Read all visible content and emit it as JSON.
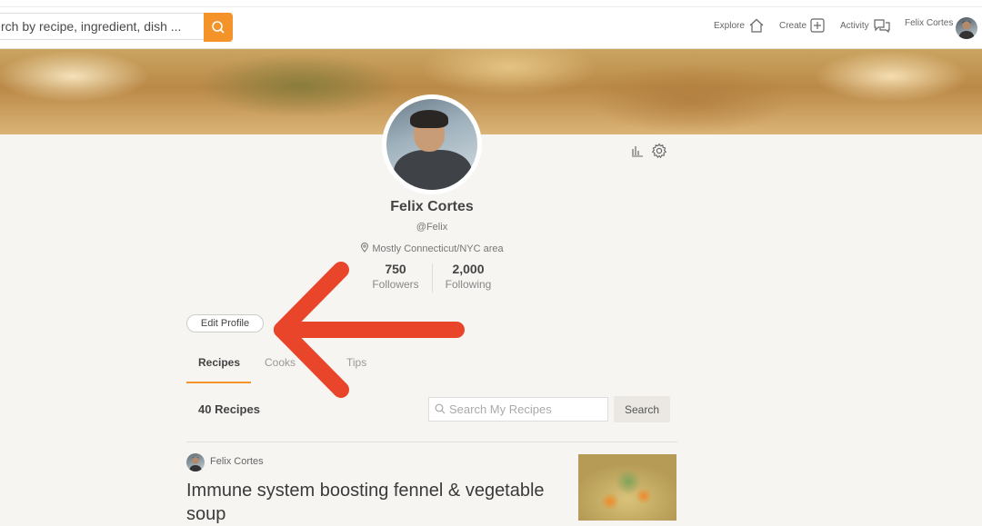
{
  "header": {
    "search_placeholder": "rch by recipe, ingredient, dish ...",
    "nav": {
      "explore": "Explore",
      "create": "Create",
      "activity": "Activity",
      "user": "Felix Cortes"
    }
  },
  "profile": {
    "name": "Felix Cortes",
    "handle": "@Felix",
    "location": "Mostly Connecticut/NYC area",
    "followers_count": "750",
    "followers_label": "Followers",
    "following_count": "2,000",
    "following_label": "Following",
    "edit_label": "Edit Profile"
  },
  "tabs": [
    {
      "label": "Recipes",
      "active": true
    },
    {
      "label": "Cooks",
      "active": false
    },
    {
      "label": "Tips",
      "active": false
    }
  ],
  "recipes": {
    "count_label": "40 Recipes",
    "search_placeholder": "Search My Recipes",
    "search_button": "Search",
    "items": [
      {
        "author": "Felix Cortes",
        "title": "Immune system boosting fennel & vegetable soup"
      }
    ]
  },
  "colors": {
    "accent": "#f4932a",
    "annotation_arrow": "#e8452a"
  }
}
